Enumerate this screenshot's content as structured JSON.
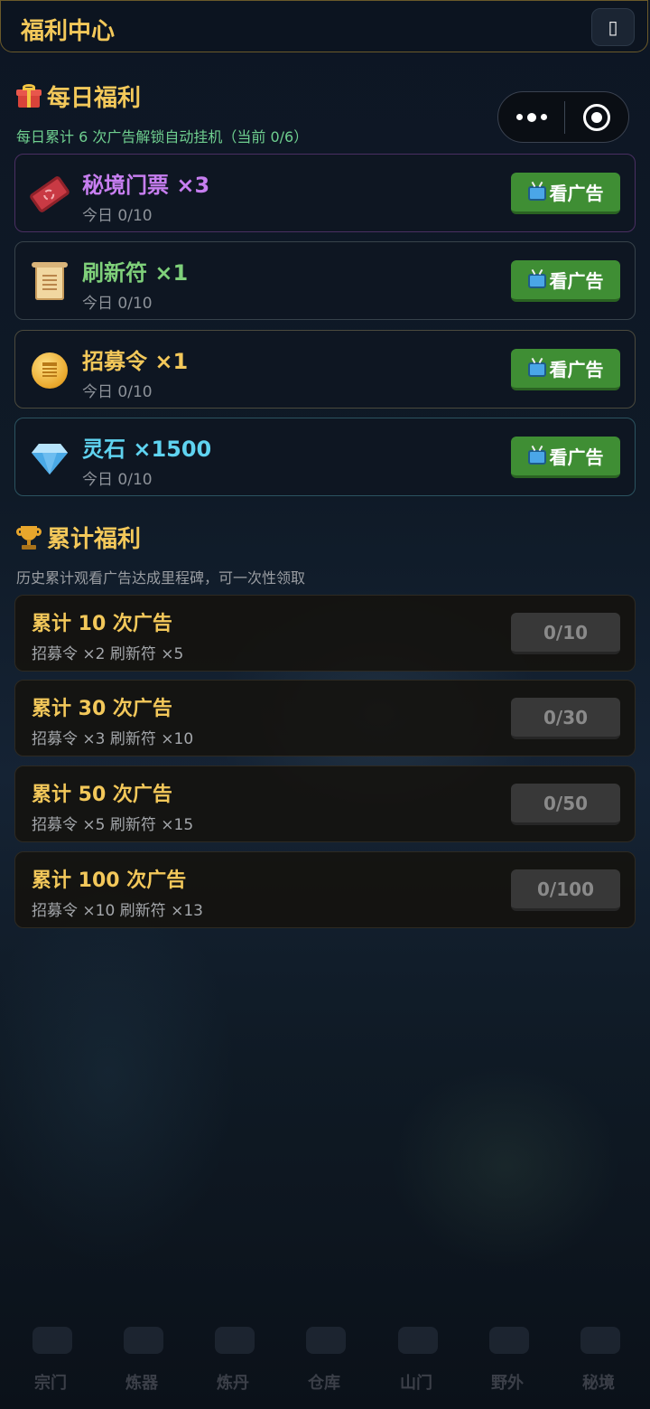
{
  "header": {
    "title": "福利中心",
    "close_glyph": "▯"
  },
  "daily": {
    "title": "每日福利",
    "icon": "gift-icon",
    "subtitle": "每日累计 6 次广告解锁自动挂机（当前 0/6）",
    "subtitle_color": "#6fcf8f",
    "items": [
      {
        "name": "秘境门票 ×3",
        "count": "今日 0/10",
        "button": "看广告",
        "icon": "ticket-icon",
        "color": "#c77ef0",
        "border": "#4a2f62"
      },
      {
        "name": "刷新符 ×1",
        "count": "今日 0/10",
        "button": "看广告",
        "icon": "scroll-icon",
        "color": "#7fd07a",
        "border": "#37424a"
      },
      {
        "name": "招募令 ×1",
        "count": "今日 0/10",
        "button": "看广告",
        "icon": "coin-icon",
        "color": "#f3c85a",
        "border": "#4b4a3d"
      },
      {
        "name": "灵石 ×1500",
        "count": "今日 0/10",
        "button": "看广告",
        "icon": "gem-icon",
        "color": "#5fd3f0",
        "border": "#2b5360"
      }
    ]
  },
  "cumulative": {
    "title": "累计福利",
    "icon": "trophy-icon",
    "subtitle": "历史累计观看广告达成里程碑，可一次性领取",
    "items": [
      {
        "title": "累计 10 次广告",
        "rewards": "招募令 ×2  刷新符 ×5",
        "progress": "0/10"
      },
      {
        "title": "累计 30 次广告",
        "rewards": "招募令 ×3  刷新符 ×10",
        "progress": "0/30"
      },
      {
        "title": "累计 50 次广告",
        "rewards": "招募令 ×5  刷新符 ×15",
        "progress": "0/50"
      },
      {
        "title": "累计 100 次广告",
        "rewards": "招募令 ×10  刷新符 ×13",
        "progress": "0/100"
      }
    ]
  },
  "nav": {
    "items": [
      {
        "label": "宗门"
      },
      {
        "label": "炼器"
      },
      {
        "label": "炼丹"
      },
      {
        "label": "仓库"
      },
      {
        "label": "山门"
      },
      {
        "label": "野外"
      },
      {
        "label": "秘境"
      }
    ]
  },
  "colors": {
    "accent": "#f3c85a",
    "ad_button": "#3f8e34",
    "progress_button": "#383838"
  }
}
